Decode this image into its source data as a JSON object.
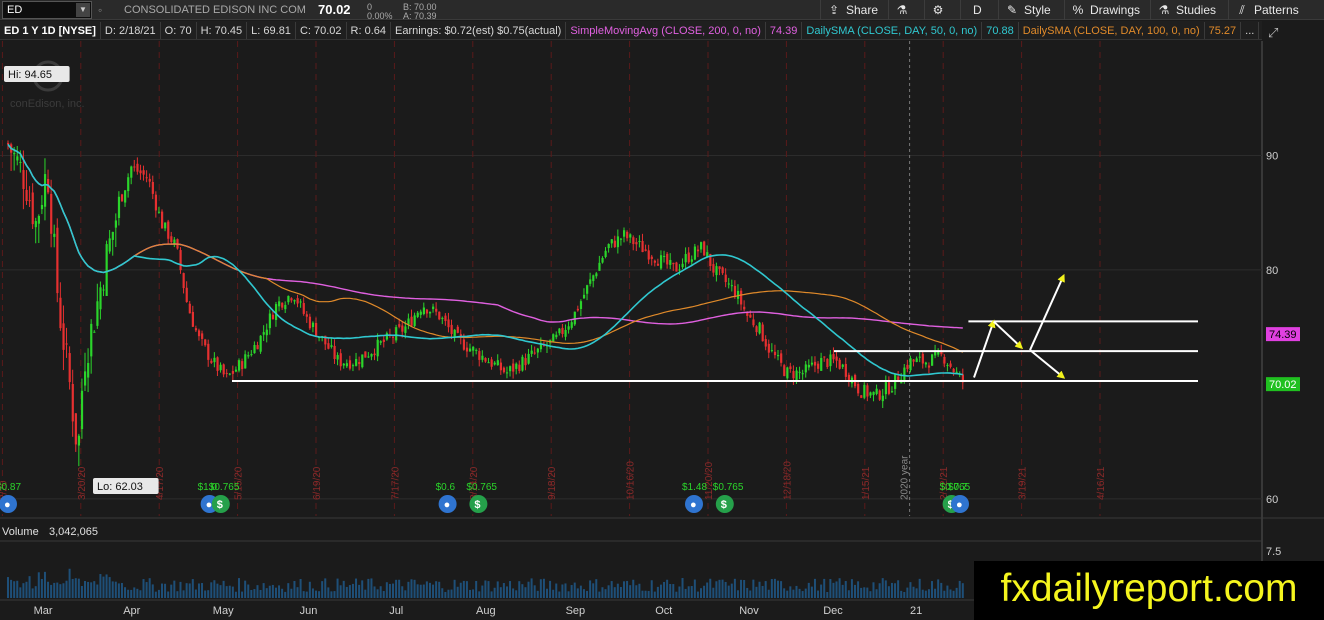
{
  "toolbar": {
    "symbol": "ED",
    "company": "CONSOLIDATED EDISON INC COM",
    "last": "70.02",
    "change": "0",
    "change_pct": "0.00%",
    "bid": "B: 70.00",
    "ask": "A: 70.39",
    "share_label": "Share",
    "interval_label": "D",
    "style_label": "Style",
    "drawings_label": "Drawings",
    "studies_label": "Studies",
    "patterns_label": "Patterns"
  },
  "infobar": {
    "title": "ED 1 Y 1D [NYSE]",
    "date": "D: 2/18/21",
    "open": "O: 70",
    "high": "H: 70.45",
    "low": "L: 69.81",
    "close": "C: 70.02",
    "range": "R: 0.64",
    "earnings": "Earnings: $0.72(est) $0.75(actual)",
    "sma200": "SimpleMovingAvg (CLOSE, 200, 0, no)",
    "sma200_val": "74.39",
    "sma50": "DailySMA (CLOSE, DAY, 50, 0, no)",
    "sma50_val": "70.88",
    "sma100": "DailySMA (CLOSE, DAY, 100, 0, no)",
    "sma100_val": "75.27",
    "more": "..."
  },
  "chart_data": {
    "type": "candlestick",
    "hi_label": "Hi: 94.65",
    "lo_label": "Lo: 62.03",
    "watermark_logo": "conEdison, inc.",
    "y_ticks": [
      {
        "value": 90,
        "label": "90"
      },
      {
        "value": 80,
        "label": "80"
      },
      {
        "value": 60,
        "label": "60"
      }
    ],
    "price_tags": [
      {
        "value": 74.39,
        "label": "74.39",
        "color": "#e040e0",
        "text": "#000000"
      },
      {
        "value": 70.02,
        "label": "70.02",
        "color": "#20c020",
        "text": "#ffffff"
      }
    ],
    "months": [
      "Mar",
      "Apr",
      "May",
      "Jun",
      "Jul",
      "Aug",
      "Sep",
      "Oct",
      "Nov",
      "Dec",
      "21"
    ],
    "date_labels": [
      {
        "day": -2,
        "text": "2/20"
      },
      {
        "day": 26,
        "text": "3/20/20"
      },
      {
        "day": 54,
        "text": "4/17/20"
      },
      {
        "day": 82,
        "text": "5/15/20"
      },
      {
        "day": 110,
        "text": "6/19/20"
      },
      {
        "day": 138,
        "text": "7/17/20"
      },
      {
        "day": 166,
        "text": "8/14/20"
      },
      {
        "day": 194,
        "text": "9/18/20"
      },
      {
        "day": 222,
        "text": "10/16/20"
      },
      {
        "day": 250,
        "text": "11/20/20"
      },
      {
        "day": 278,
        "text": "12/18/20"
      },
      {
        "day": 306,
        "text": "1/15/21"
      },
      {
        "day": 334,
        "text": "2/12/21"
      },
      {
        "day": 362,
        "text": "3/19/21"
      },
      {
        "day": 390,
        "text": "4/16/21"
      }
    ],
    "year_label": "2020 year",
    "event_markers": [
      {
        "day": 0,
        "kind": "bulb",
        "label": "$0.87"
      },
      {
        "day": 72,
        "kind": "bulb",
        "label": "$1.0"
      },
      {
        "day": 76,
        "kind": "dollar",
        "label": "$0.765"
      },
      {
        "day": 157,
        "kind": "bulb",
        "label": "$0.6"
      },
      {
        "day": 168,
        "kind": "dollar",
        "label": "$0.765"
      },
      {
        "day": 245,
        "kind": "bulb",
        "label": "$1.48"
      },
      {
        "day": 256,
        "kind": "dollar",
        "label": "$0.765"
      },
      {
        "day": 337,
        "kind": "dollar",
        "label": "$0.765"
      },
      {
        "day": 340,
        "kind": "bulb",
        "label": "$0.7"
      }
    ],
    "horizontal_lines": [
      {
        "from_day": 80,
        "to_day": 425,
        "value": 70.3
      },
      {
        "from_day": 295,
        "to_day": 425,
        "value": 72.9
      },
      {
        "from_day": 343,
        "to_day": 425,
        "value": 75.5
      }
    ],
    "projection_arrows": [
      {
        "color": "#ffffff",
        "points": [
          [
            345,
            70.6
          ],
          [
            352,
            75.5
          ]
        ]
      },
      {
        "color": "#ffffff",
        "points": [
          [
            352,
            75.5
          ],
          [
            362,
            73.2
          ]
        ]
      },
      {
        "color": "#ffffff",
        "points": [
          [
            365,
            73.0
          ],
          [
            377,
            79.5
          ]
        ]
      },
      {
        "color": "#ffffff",
        "points": [
          [
            365,
            73.0
          ],
          [
            377,
            70.6
          ]
        ]
      }
    ],
    "volume_label": "Volume",
    "volume_value": "3,042,065",
    "volume_tick": "7.5",
    "y_range": [
      58.5,
      100
    ],
    "sma_colors": {
      "sma200": "#e060e0",
      "sma50": "#30c8d0",
      "sma100": "#e08a2a"
    }
  },
  "watermark": "fxdailyreport.com"
}
